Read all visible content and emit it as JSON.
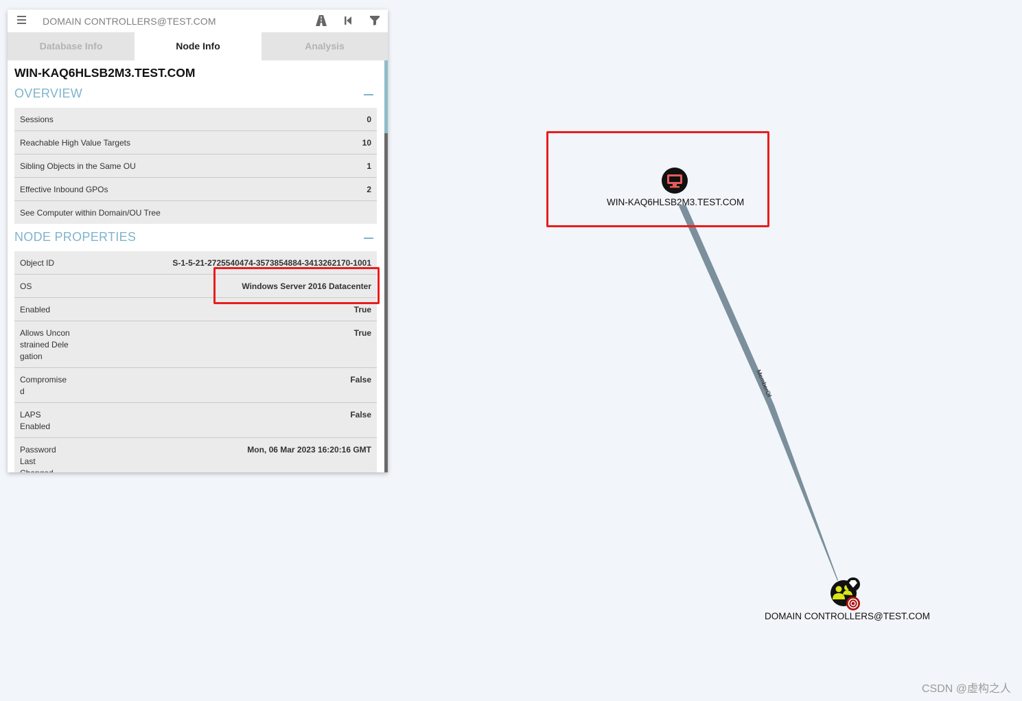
{
  "searchbar": {
    "query": "DOMAIN CONTROLLERS@TEST.COM",
    "icons": [
      "menu-icon",
      "pathfinding-icon",
      "back-icon",
      "filter-icon"
    ]
  },
  "tabs": [
    {
      "label": "Database Info",
      "active": false
    },
    {
      "label": "Node Info",
      "active": true
    },
    {
      "label": "Analysis",
      "active": false
    }
  ],
  "node_info": {
    "title": "WIN-KAQ6HLSB2M3.TEST.COM",
    "overview": {
      "heading": "OVERVIEW",
      "rows": [
        {
          "label": "Sessions",
          "value": "0"
        },
        {
          "label": "Reachable High Value Targets",
          "value": "10"
        },
        {
          "label": "Sibling Objects in the Same OU",
          "value": "1"
        },
        {
          "label": "Effective Inbound GPOs",
          "value": "2"
        },
        {
          "label": "See Computer within Domain/OU Tree",
          "value": ""
        }
      ]
    },
    "properties": {
      "heading": "NODE PROPERTIES",
      "rows": [
        {
          "label": "Object ID",
          "value": "S-1-5-21-2725540474-3573854884-3413262170-1001"
        },
        {
          "label": "OS",
          "value": "Windows Server 2016 Datacenter"
        },
        {
          "label": "Enabled",
          "value": "True"
        },
        {
          "label": "Allows Unconstrained Delegation",
          "value": "True"
        },
        {
          "label": "Compromised",
          "value": "False"
        },
        {
          "label": "LAPS Enabled",
          "value": "False"
        },
        {
          "label": "Password Last Changed",
          "value": "Mon, 06 Mar 2023 16:20:16 GMT"
        }
      ]
    }
  },
  "graph": {
    "computer_node": {
      "label": "WIN-KAQ6HLSB2M3.TEST.COM",
      "icon": "computer-icon",
      "color": "#e85a5a"
    },
    "group_node": {
      "label": "DOMAIN CONTROLLERS@TEST.COM",
      "icon": "group-icon",
      "color": "#dbe617",
      "badges": [
        "high-value-diamond-icon",
        "target-icon"
      ]
    },
    "edge": {
      "label": "MemberOf",
      "color": "#7b8f9c"
    }
  },
  "colors": {
    "accent": "#7fb4cc",
    "highlight": "#ea1c1c",
    "background": "#f2f5f9"
  },
  "watermark": "CSDN @虚构之人"
}
